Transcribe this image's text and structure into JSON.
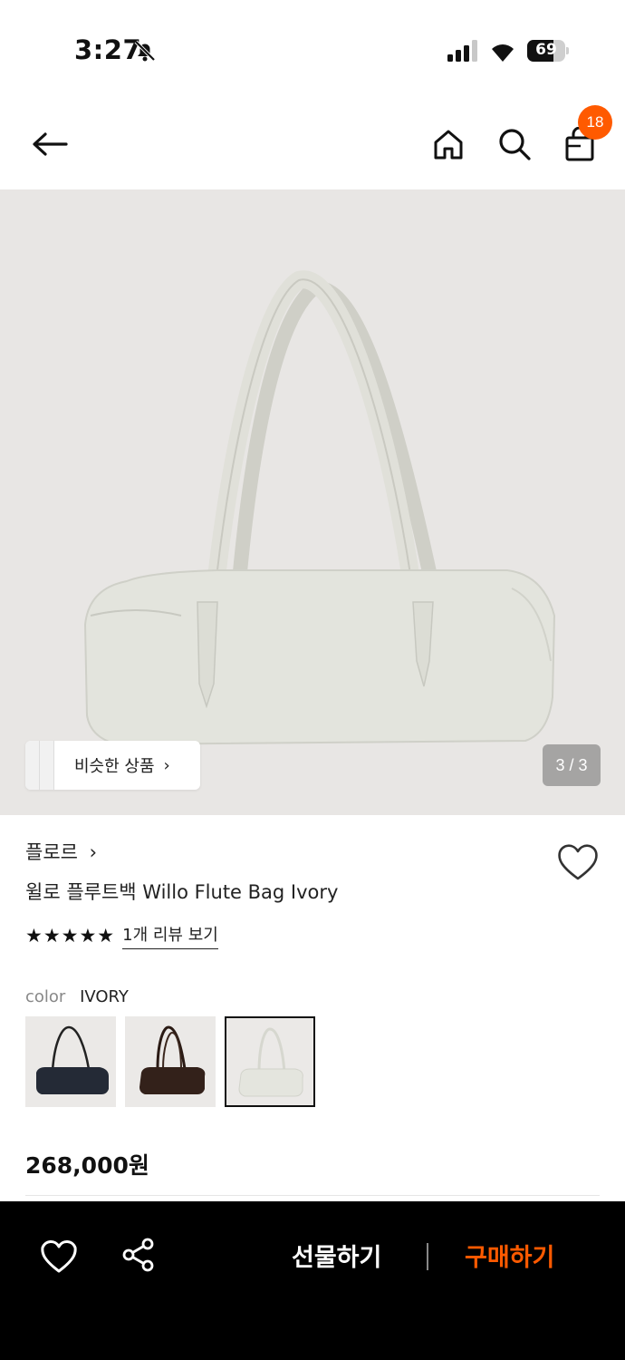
{
  "status": {
    "time": "3:27",
    "battery": "69",
    "battery_level": 0.69
  },
  "nav": {
    "cart_count": "18"
  },
  "gallery": {
    "similar_label": "비슷한 상품",
    "pager": "3 / 3"
  },
  "product": {
    "brand": "플로르",
    "name": "윌로 플루트백 Willo Flute Bag Ivory",
    "rating_stars": "★★★★★",
    "rating_value": 5,
    "review_link": "1개 리뷰 보기",
    "color_key": "color",
    "color_value": "IVORY",
    "swatches": [
      "navy",
      "brown",
      "ivory"
    ],
    "price": "268,000원"
  },
  "bottom": {
    "gift_label": "선물하기",
    "buy_label": "구매하기"
  },
  "colors": {
    "accent": "#ff5a00",
    "bar": "#000000",
    "hero_bg": "#e8e6e4"
  }
}
